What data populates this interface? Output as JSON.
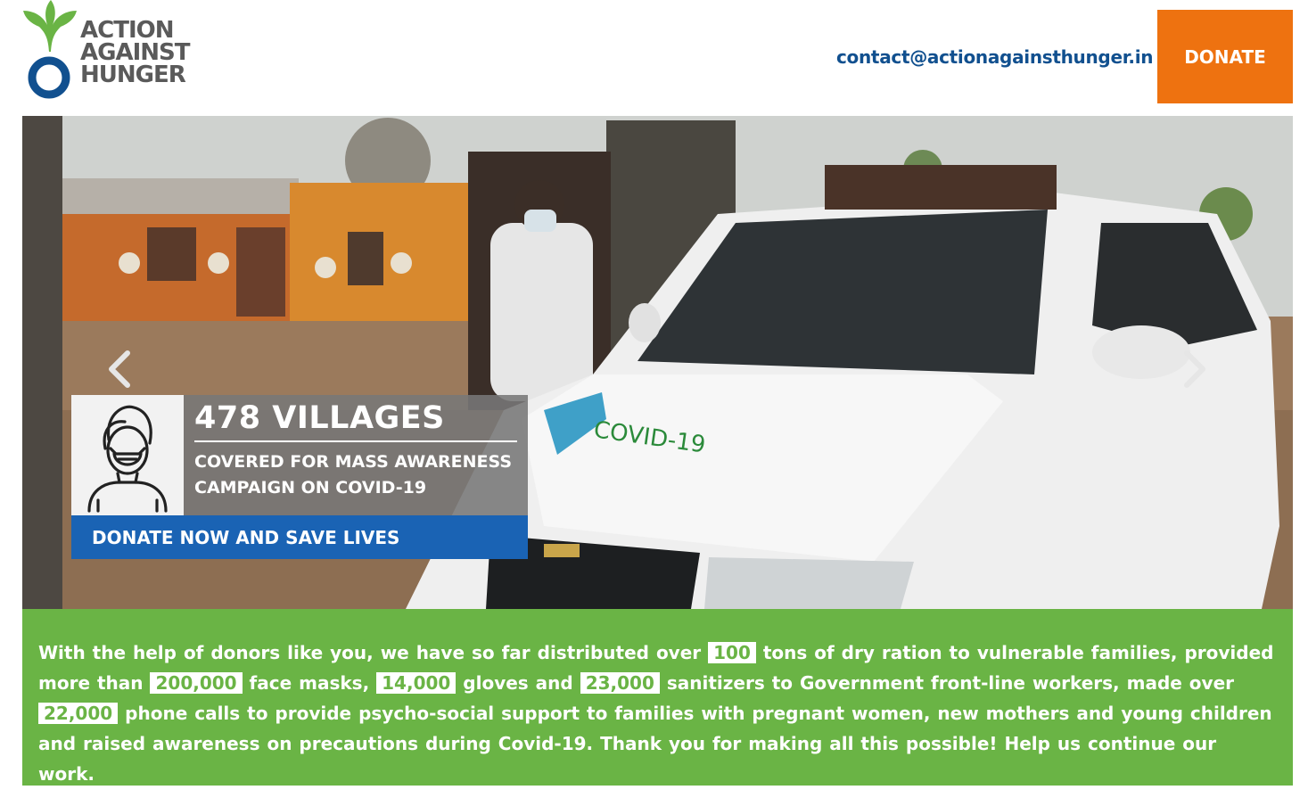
{
  "header": {
    "logo": {
      "line1": "ACTION",
      "line2": "AGAINST",
      "line3": "HUNGER",
      "icon": "leaf-drop-logo"
    },
    "contact_email": "contact@actionagainsthunger.in",
    "donate_label": "DONATE"
  },
  "hero": {
    "stat_title": "478 VILLAGES",
    "stat_subtitle": "COVERED FOR MASS AWARENESS CAMPAIGN ON COVID-19",
    "cta_label": "DONATE NOW AND SAVE LIVES",
    "icon": "masked-person-icon",
    "prev_icon": "chevron-left-icon",
    "next_icon": "chevron-right-icon"
  },
  "impact": {
    "part1": "With the help of donors like you, we have so far distributed over",
    "tons": "100",
    "part2": "tons of dry ration to vulnerable families, provided more than",
    "masks": "200,000",
    "part3": "face masks,",
    "gloves": "14,000",
    "part4": "gloves and",
    "sanitizers": "23,000",
    "part5": "sanitizers to Government front-line workers, made over",
    "calls": "22,000",
    "part6": "phone calls to provide psycho-social support to families with pregnant women, new mothers and young children and raised awareness on precautions during Covid-19. Thank you for making all this possible! Help us continue our work."
  },
  "colors": {
    "brand_green": "#6ab445",
    "brand_blue": "#11508f",
    "donate_orange": "#ee7210",
    "cta_blue": "#1a63b4"
  }
}
